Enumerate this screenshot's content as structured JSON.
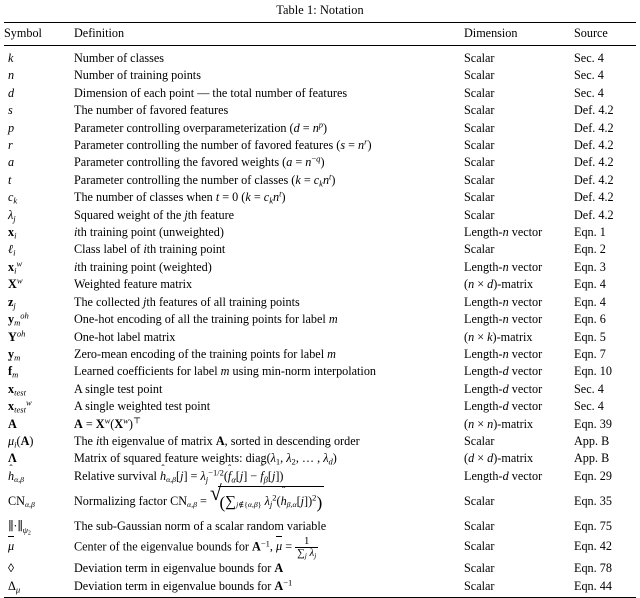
{
  "caption": "Table 1: Notation",
  "columns": [
    "Symbol",
    "Definition",
    "Dimension",
    "Source"
  ],
  "rows": [
    {
      "symbol_plain": "k",
      "definition": "Number of classes",
      "dimension": "Scalar",
      "source": "Sec. 4"
    },
    {
      "symbol_plain": "n",
      "definition": "Number of training points",
      "dimension": "Scalar",
      "source": "Sec. 4"
    },
    {
      "symbol_plain": "d",
      "definition": "Dimension of each point — the total number of features",
      "dimension": "Scalar",
      "source": "Sec. 4"
    },
    {
      "symbol_plain": "s",
      "definition": "The number of favored features",
      "dimension": "Scalar",
      "source": "Def. 4.2"
    },
    {
      "symbol_plain": "p",
      "definition": "Parameter controlling overparameterization (d = n^p)",
      "dimension": "Scalar",
      "source": "Def. 4.2"
    },
    {
      "symbol_plain": "r",
      "definition": "Parameter controlling the number of favored features (s = n^r)",
      "dimension": "Scalar",
      "source": "Def. 4.2"
    },
    {
      "symbol_plain": "a",
      "definition": "Parameter controlling the favored weights (a = n^-q)",
      "dimension": "Scalar",
      "source": "Def. 4.2"
    },
    {
      "symbol_plain": "t",
      "definition": "Parameter controlling the number of classes (k = c_k n^t)",
      "dimension": "Scalar",
      "source": "Def. 4.2"
    },
    {
      "symbol_plain": "c_k",
      "definition": "The number of classes when t = 0 (k = c_k n^t)",
      "dimension": "Scalar",
      "source": "Def. 4.2"
    },
    {
      "symbol_plain": "lambda_j",
      "definition": "Squared weight of the jth feature",
      "dimension": "Scalar",
      "source": "Def. 4.2"
    },
    {
      "symbol_plain": "x_i",
      "definition": "ith training point (unweighted)",
      "dimension": "Length-n vector",
      "source": "Eqn. 1"
    },
    {
      "symbol_plain": "ell_i",
      "definition": "Class label of ith training point",
      "dimension": "Scalar",
      "source": "Eqn. 2"
    },
    {
      "symbol_plain": "x_i^w",
      "definition": "ith training point (weighted)",
      "dimension": "Length-n vector",
      "source": "Eqn. 3"
    },
    {
      "symbol_plain": "X^w",
      "definition": "Weighted feature matrix",
      "dimension": "(n × d)-matrix",
      "source": "Eqn. 4"
    },
    {
      "symbol_plain": "z_j",
      "definition": "The collected jth features of all training points",
      "dimension": "Length-n vector",
      "source": "Eqn. 4"
    },
    {
      "symbol_plain": "y_m^oh",
      "definition": "One-hot encoding of all the training points for label m",
      "dimension": "Length-n vector",
      "source": "Eqn. 6"
    },
    {
      "symbol_plain": "Y^oh",
      "definition": "One-hot label matrix",
      "dimension": "(n × k)-matrix",
      "source": "Eqn. 5"
    },
    {
      "symbol_plain": "y_m",
      "definition": "Zero-mean encoding of the training points for label m",
      "dimension": "Length-n vector",
      "source": "Eqn. 7"
    },
    {
      "symbol_plain": "f-hat_m",
      "definition": "Learned coefficients for label m using min-norm interpolation",
      "dimension": "Length-d vector",
      "source": "Eqn. 10"
    },
    {
      "symbol_plain": "x_test",
      "definition": "A single test point",
      "dimension": "Length-d vector",
      "source": "Sec. 4"
    },
    {
      "symbol_plain": "x_test^w",
      "definition": "A single weighted test point",
      "dimension": "Length-d vector",
      "source": "Sec. 4"
    },
    {
      "symbol_plain": "A",
      "definition": "A = X^w (X^w)^T",
      "dimension": "(n × n)-matrix",
      "source": "Eqn. 39"
    },
    {
      "symbol_plain": "mu_i(A)",
      "definition": "The ith eigenvalue of matrix A, sorted in descending order",
      "dimension": "Scalar",
      "source": "App. B"
    },
    {
      "symbol_plain": "Lambda",
      "definition": "Matrix of squared feature weights: diag(λ1, λ2, …, λd)",
      "dimension": "(d × d)-matrix",
      "source": "App. B"
    },
    {
      "symbol_plain": "h-hat_alpha,beta",
      "definition": "Relative survival ĥ_{α,β}[j] = λ_j^{-1/2}(f̂_α[j] − f̂_β[j])",
      "dimension": "Length-d vector",
      "source": "Eqn. 29"
    },
    {
      "symbol_plain": "CN_alpha,beta",
      "definition": "Normalizing factor CN_{α,β} = sqrt( Σ_{j ∉ {α,β}} λ_j^2 (ĥ_{β,α}[j])^2 )",
      "dimension": "Scalar",
      "source": "Eqn. 35"
    },
    {
      "symbol_plain": "norm_psi2",
      "definition": "The sub-Gaussian norm of a scalar random variable",
      "dimension": "Scalar",
      "source": "Eqn. 75"
    },
    {
      "symbol_plain": "mu-bar",
      "definition": "Center of the eigenvalue bounds for A^-1, μ̄ = 1 / Σ_j λ_j",
      "dimension": "Scalar",
      "source": "Eqn. 42"
    },
    {
      "symbol_plain": "diamond",
      "definition": "Deviation term in eigenvalue bounds for A",
      "dimension": "Scalar",
      "source": "Eqn. 78"
    },
    {
      "symbol_plain": "Delta_mu",
      "definition": "Deviation term in eigenvalue bounds for A^-1",
      "dimension": "Scalar",
      "source": "Eqn. 44"
    }
  ]
}
